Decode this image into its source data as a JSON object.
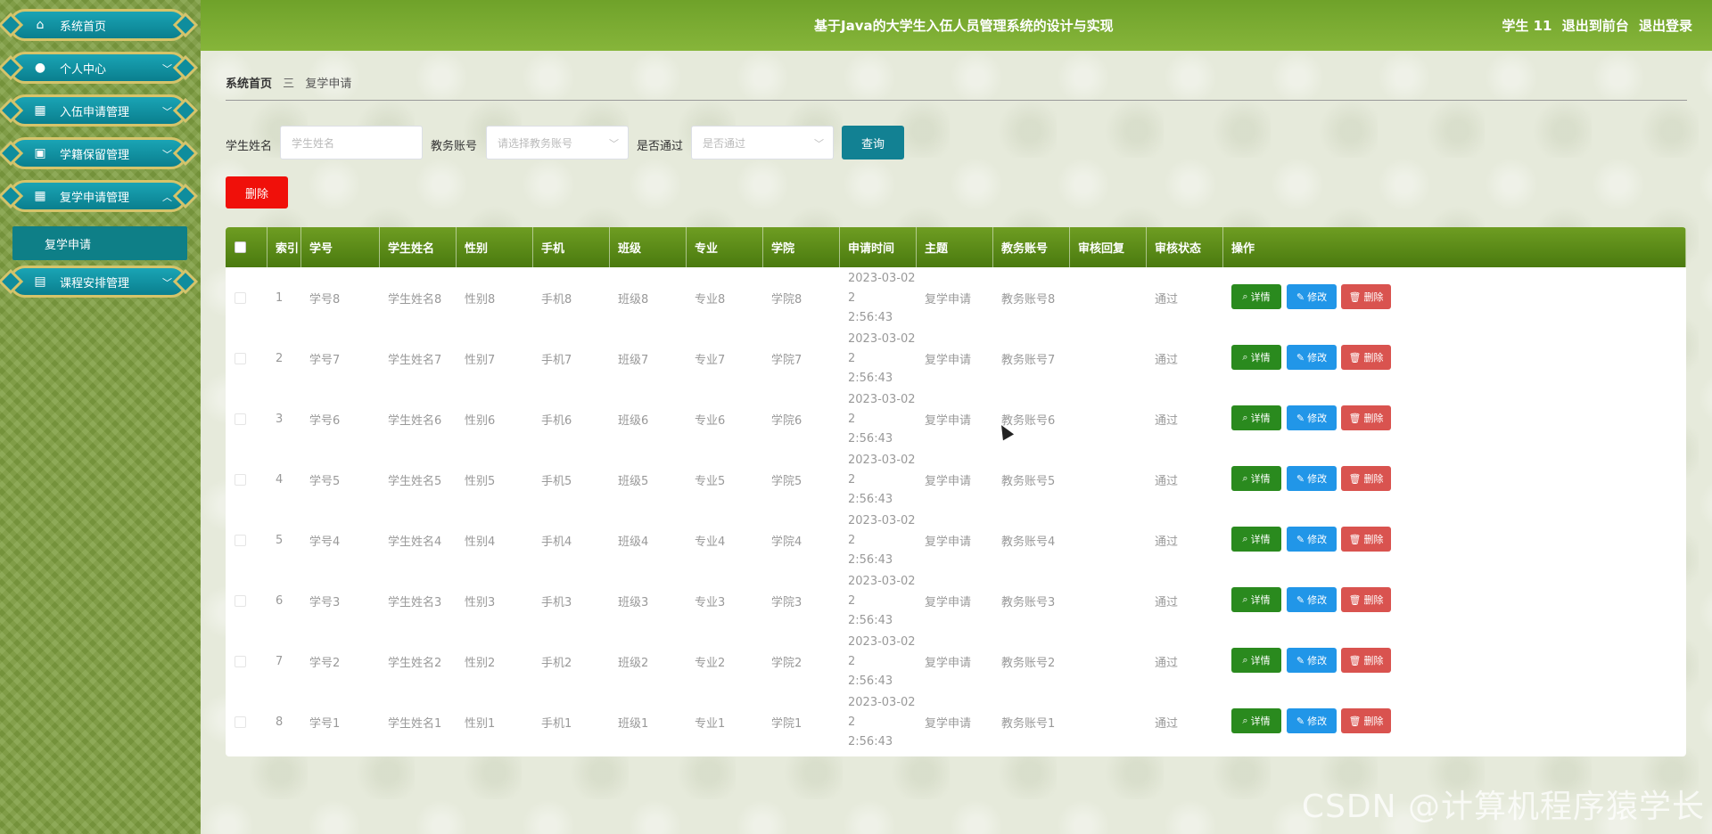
{
  "header": {
    "title": "基于Java的大学生入伍人员管理系统的设计与实现",
    "user": "学生 11",
    "back_front": "退出到前台",
    "logout": "退出登录"
  },
  "sidebar": {
    "items": [
      {
        "label": "系统首页",
        "icon": "home-icon"
      },
      {
        "label": "个人中心",
        "icon": "user-icon"
      },
      {
        "label": "入伍申请管理",
        "icon": "grid-icon"
      },
      {
        "label": "学籍保留管理",
        "icon": "briefcase-icon"
      },
      {
        "label": "复学申请管理",
        "icon": "grid-icon"
      },
      {
        "label": "课程安排管理",
        "icon": "clipboard-icon"
      }
    ],
    "active_sub": "复学申请"
  },
  "breadcrumb": {
    "home": "系统首页",
    "sep": "三",
    "current": "复学申请"
  },
  "search": {
    "name_label": "学生姓名",
    "name_placeholder": "学生姓名",
    "account_label": "教务账号",
    "account_placeholder": "请选择教务账号",
    "pass_label": "是否通过",
    "pass_placeholder": "是否通过",
    "query": "查询"
  },
  "toolbar": {
    "delete": "删除"
  },
  "table": {
    "headers": [
      "索引",
      "学号",
      "学生姓名",
      "性别",
      "手机",
      "班级",
      "专业",
      "学院",
      "申请时间",
      "主题",
      "教务账号",
      "审核回复",
      "审核状态",
      "操作"
    ],
    "rows": [
      {
        "idx": "1",
        "sid": "学号8",
        "name": "学生姓名8",
        "gender": "性别8",
        "phone": "手机8",
        "cls": "班级8",
        "major": "专业8",
        "college": "学院8",
        "time1": "2023-03-02 2",
        "time2": "2:56:43",
        "topic": "复学申请",
        "account": "教务账号8",
        "reply": "",
        "status": "通过"
      },
      {
        "idx": "2",
        "sid": "学号7",
        "name": "学生姓名7",
        "gender": "性别7",
        "phone": "手机7",
        "cls": "班级7",
        "major": "专业7",
        "college": "学院7",
        "time1": "2023-03-02 2",
        "time2": "2:56:43",
        "topic": "复学申请",
        "account": "教务账号7",
        "reply": "",
        "status": "通过"
      },
      {
        "idx": "3",
        "sid": "学号6",
        "name": "学生姓名6",
        "gender": "性别6",
        "phone": "手机6",
        "cls": "班级6",
        "major": "专业6",
        "college": "学院6",
        "time1": "2023-03-02 2",
        "time2": "2:56:43",
        "topic": "复学申请",
        "account": "教务账号6",
        "reply": "",
        "status": "通过"
      },
      {
        "idx": "4",
        "sid": "学号5",
        "name": "学生姓名5",
        "gender": "性别5",
        "phone": "手机5",
        "cls": "班级5",
        "major": "专业5",
        "college": "学院5",
        "time1": "2023-03-02 2",
        "time2": "2:56:43",
        "topic": "复学申请",
        "account": "教务账号5",
        "reply": "",
        "status": "通过"
      },
      {
        "idx": "5",
        "sid": "学号4",
        "name": "学生姓名4",
        "gender": "性别4",
        "phone": "手机4",
        "cls": "班级4",
        "major": "专业4",
        "college": "学院4",
        "time1": "2023-03-02 2",
        "time2": "2:56:43",
        "topic": "复学申请",
        "account": "教务账号4",
        "reply": "",
        "status": "通过"
      },
      {
        "idx": "6",
        "sid": "学号3",
        "name": "学生姓名3",
        "gender": "性别3",
        "phone": "手机3",
        "cls": "班级3",
        "major": "专业3",
        "college": "学院3",
        "time1": "2023-03-02 2",
        "time2": "2:56:43",
        "topic": "复学申请",
        "account": "教务账号3",
        "reply": "",
        "status": "通过"
      },
      {
        "idx": "7",
        "sid": "学号2",
        "name": "学生姓名2",
        "gender": "性别2",
        "phone": "手机2",
        "cls": "班级2",
        "major": "专业2",
        "college": "学院2",
        "time1": "2023-03-02 2",
        "time2": "2:56:43",
        "topic": "复学申请",
        "account": "教务账号2",
        "reply": "",
        "status": "通过"
      },
      {
        "idx": "8",
        "sid": "学号1",
        "name": "学生姓名1",
        "gender": "性别1",
        "phone": "手机1",
        "cls": "班级1",
        "major": "专业1",
        "college": "学院1",
        "time1": "2023-03-02 2",
        "time2": "2:56:43",
        "topic": "复学申请",
        "account": "教务账号1",
        "reply": "",
        "status": "通过"
      }
    ],
    "actions": {
      "detail": "详情",
      "edit": "修改",
      "delete": "删除"
    }
  },
  "watermark": "CSDN @计算机程序猿学长",
  "colors": {
    "header": "#7aab2e",
    "sidebar": "#7d9d3f",
    "menu": "#0f8d9d",
    "query": "#128193",
    "delete": "#f0100a",
    "detail": "#2a8a1e",
    "edit": "#2196e8",
    "row_delete": "#d9534f"
  }
}
